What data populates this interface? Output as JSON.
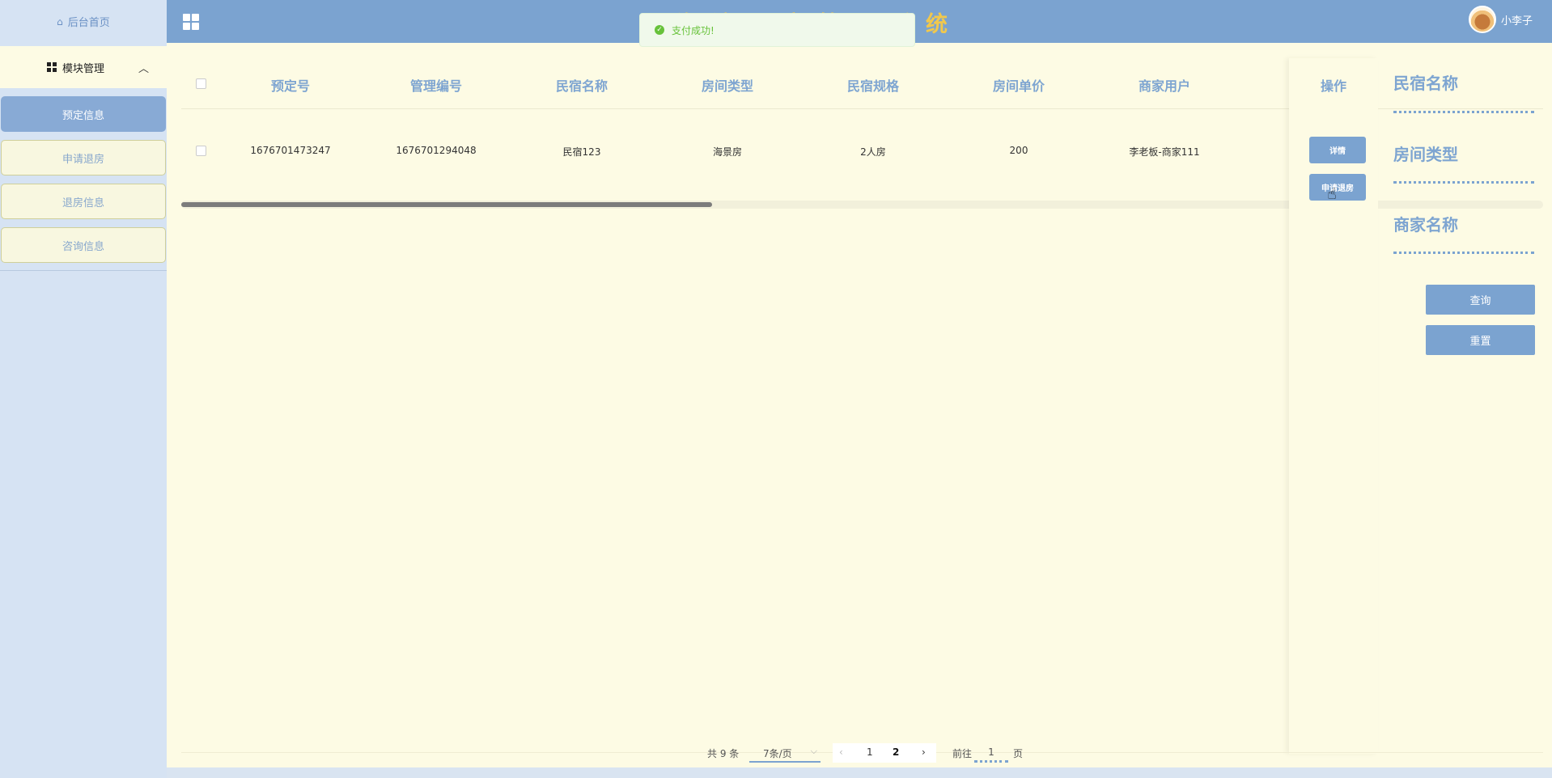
{
  "sidebar": {
    "home_label": "后台首页",
    "module_label": "模块管理",
    "items": [
      {
        "label": "预定信息",
        "active": true
      },
      {
        "label": "申请退房",
        "active": false
      },
      {
        "label": "退房信息",
        "active": false
      },
      {
        "label": "咨询信息",
        "active": false
      }
    ]
  },
  "header": {
    "title": "海滨民宿管理系统",
    "username": "小李子"
  },
  "toast": {
    "message": "支付成功!",
    "color": "#67c23a"
  },
  "table": {
    "columns": [
      "预定号",
      "管理编号",
      "民宿名称",
      "房间类型",
      "民宿规格",
      "房间单价",
      "商家用户"
    ],
    "op_column": "操作",
    "rows": [
      {
        "cells": [
          "1676701473247",
          "1676701294048",
          "民宿123",
          "海景房",
          "2人房",
          "200",
          "李老板-商家111"
        ]
      }
    ],
    "row_actions": [
      "详情",
      "申请退房"
    ],
    "scroll_fraction": 0.39
  },
  "search": {
    "fields": [
      "民宿名称",
      "房间类型",
      "商家名称"
    ],
    "query_label": "查询",
    "reset_label": "重置"
  },
  "pagination": {
    "total": "共 9 条",
    "page_size": "7条/页",
    "prev": "‹",
    "pages": [
      "1",
      "2"
    ],
    "current_page": "2",
    "next": "›",
    "goto_prefix": "前往",
    "goto_value": "1",
    "goto_suffix": "页"
  },
  "colors": {
    "accent": "#7ba3d0",
    "title": "#f1c84d",
    "panel_bg": "#fdfbe4",
    "sidebar_bg": "#d6e3f3"
  }
}
